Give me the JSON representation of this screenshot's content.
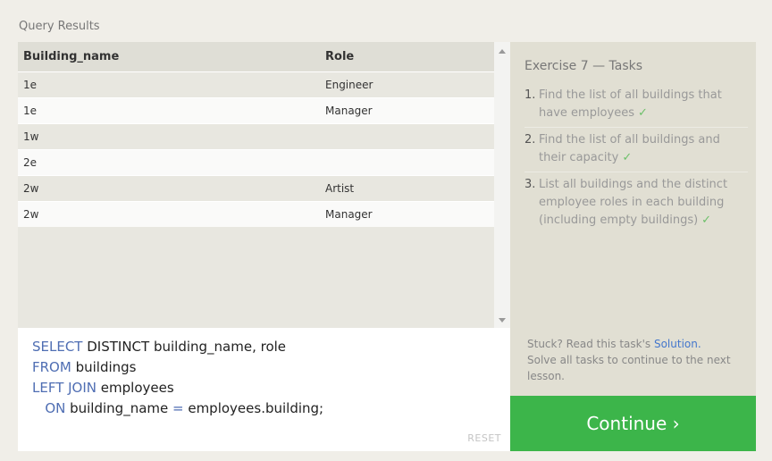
{
  "results": {
    "title": "Query Results",
    "columns": [
      "Building_name",
      "Role"
    ],
    "rows": [
      [
        "1e",
        "Engineer"
      ],
      [
        "1e",
        "Manager"
      ],
      [
        "1w",
        ""
      ],
      [
        "2e",
        ""
      ],
      [
        "2w",
        "Artist"
      ],
      [
        "2w",
        "Manager"
      ]
    ]
  },
  "editor": {
    "line1_kw": "SELECT",
    "line1_rest": " DISTINCT building_name, role",
    "line2_kw": "FROM",
    "line2_rest": " buildings",
    "line3_kw": "LEFT JOIN",
    "line3_rest": " employees",
    "line4_indent": "   ",
    "line4_kw": "ON",
    "line4_a": " building_name ",
    "line4_op": "=",
    "line4_b": " employees.building;",
    "reset_label": "RESET"
  },
  "panel": {
    "title": "Exercise 7 — Tasks",
    "tasks": [
      {
        "num": "1.",
        "text": "Find the list of all buildings that have employees",
        "check": "✓"
      },
      {
        "num": "2.",
        "text": "Find the list of all buildings and their capacity",
        "check": "✓"
      },
      {
        "num": "3.",
        "text": "List all buildings and the distinct employee roles in each building (including empty buildings)",
        "check": "✓"
      }
    ],
    "stuck_prefix": "Stuck? Read this task's ",
    "solution_link": "Solution.",
    "stuck_suffix": "Solve all tasks to continue to the next lesson."
  },
  "continue_label": "Continue ›",
  "colors": {
    "accent_green": "#3cb54a",
    "keyword_blue": "#4f6eb3",
    "link_blue": "#4477cc",
    "check_green": "#6dc06a"
  }
}
